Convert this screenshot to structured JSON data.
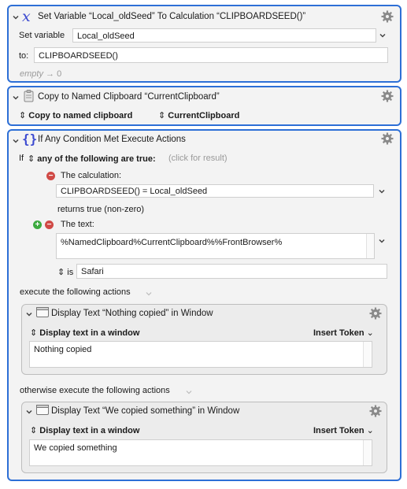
{
  "block1": {
    "title": "Set Variable “Local_oldSeed” To Calculation “CLIPBOARDSEED()”",
    "set_variable_label": "Set variable",
    "variable_name": "Local_oldSeed",
    "to_label": "to:",
    "to_value": "CLIPBOARDSEED()",
    "empty_label": "empty",
    "empty_result": "→ 0"
  },
  "block2": {
    "title": "Copy to Named Clipboard “CurrentClipboard”",
    "action_select": "Copy to named clipboard",
    "clipboard_select": "CurrentClipboard"
  },
  "block3": {
    "title": "If Any Condition Met Execute Actions",
    "if_label": "If",
    "condition_mode": "any of the following are true:",
    "click_result": "(click for result)",
    "cond1_label": "The calculation:",
    "cond1_value": "CLIPBOARDSEED() = Local_oldSeed",
    "cond1_returns": "returns true (non-zero)",
    "cond2_label": "The text:",
    "cond2_value": "%NamedClipboard%CurrentClipboard%%FrontBrowser%",
    "cond2_op": "is",
    "cond2_match": "Safari",
    "execute_label": "execute the following actions",
    "otherwise_label": "otherwise execute the following actions",
    "sub1": {
      "title": "Display Text “Nothing copied” in Window",
      "mode": "Display text in a window",
      "insert_token": "Insert Token",
      "text": "Nothing copied"
    },
    "sub2": {
      "title": "Display Text “We copied something” in Window",
      "mode": "Display text in a window",
      "insert_token": "Insert Token",
      "text": "We copied something"
    }
  },
  "colors": {
    "block_border": "#2d6fd6",
    "variable_icon": "#3b49d0",
    "condition_icon": "#3b49d0",
    "minus": "#d04a46",
    "plus": "#3cab3f"
  },
  "icons": [
    "chevron-down-icon",
    "variable-x-icon",
    "clipboard-icon",
    "braces-icon",
    "gear-icon",
    "window-icon",
    "updown-select-icon",
    "plus-icon",
    "minus-icon"
  ]
}
